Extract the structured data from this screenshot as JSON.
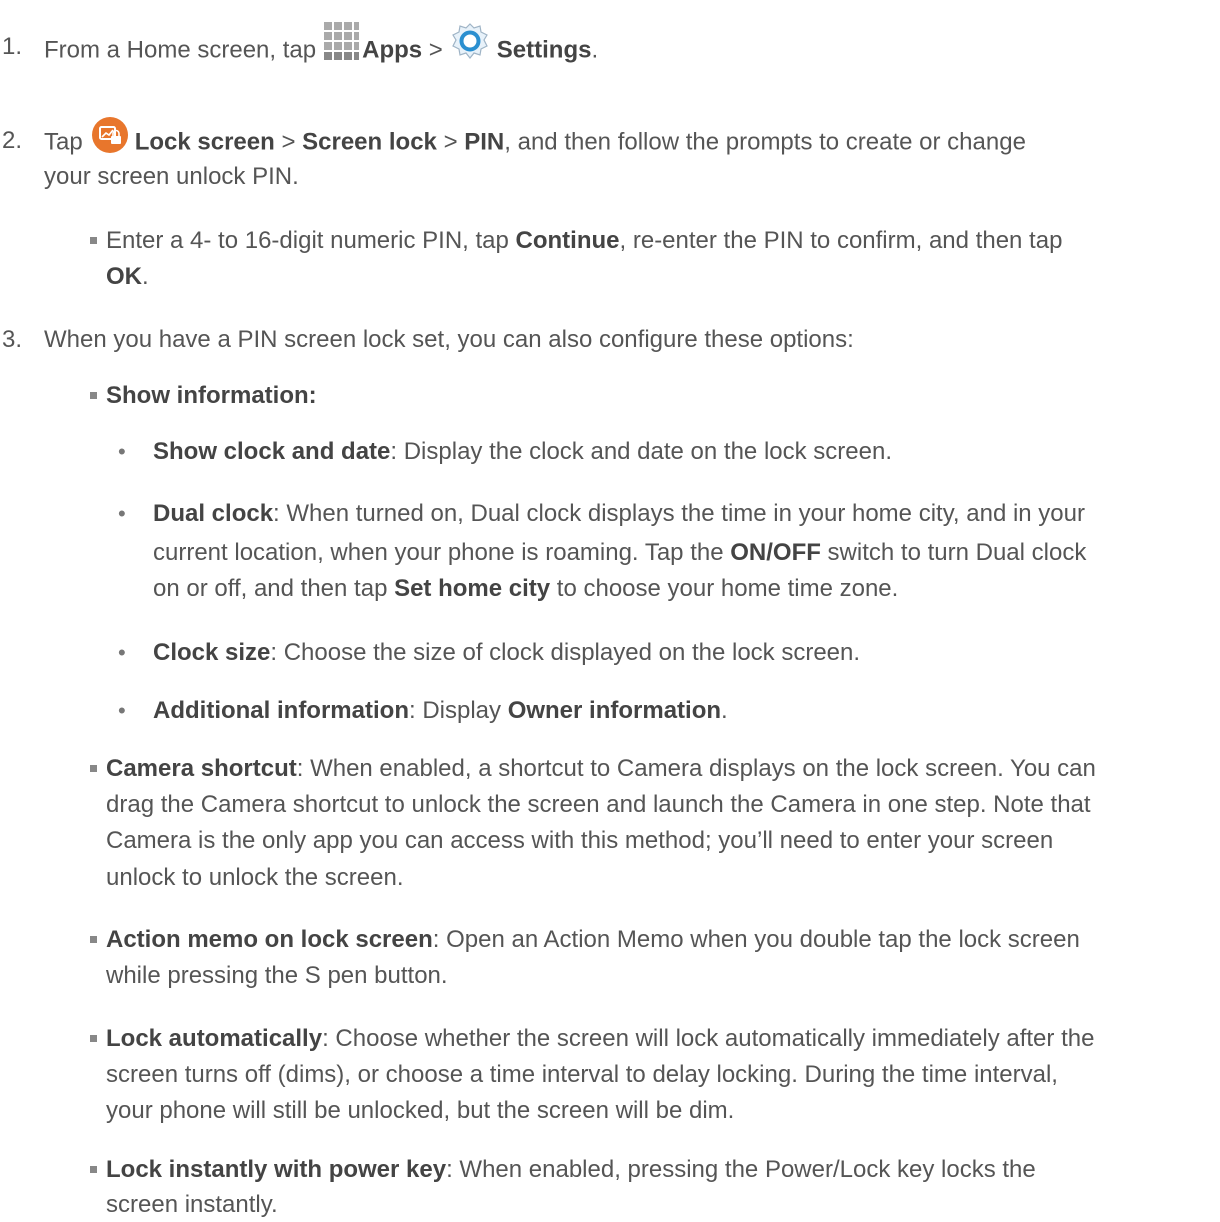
{
  "step1": {
    "number": "1.",
    "prefix": "From a Home screen, tap",
    "apps": "Apps",
    "sep": ">",
    "settings": "Settings",
    "end": "."
  },
  "step2": {
    "number": "2.",
    "tap": "Tap",
    "lock_screen": "Lock screen",
    "sep1": ">",
    "screen_lock": "Screen lock",
    "sep2": ">",
    "pin": "PIN",
    "rest": ", and then follow the prompts to create or change",
    "line2": "your screen unlock PIN.",
    "sub": {
      "line1_a": "Enter a 4- to 16-digit numeric PIN, tap ",
      "continue": "Continue",
      "line1_b": ", re-enter the PIN to confirm, and then tap",
      "ok": "OK",
      "end": "."
    }
  },
  "step3": {
    "number": "3.",
    "intro": "When you have a PIN screen lock set, you can also configure these options:",
    "show_information": "Show information:",
    "show_clock": {
      "title": "Show clock and date",
      "text": ": Display the clock and date on the lock screen."
    },
    "dual_clock": {
      "title": "Dual clock",
      "line1": ": When turned on, Dual clock displays the time in your home city, and in your",
      "line2_a": "current location, when your phone is roaming. Tap the ",
      "onoff": "ON/OFF",
      "line2_b": " switch to turn Dual clock",
      "line3_a": "on or off, and then tap ",
      "set_home": "Set home city",
      "line3_b": " to choose your home time zone."
    },
    "clock_size": {
      "title": "Clock size",
      "text": ": Choose the size of clock displayed on the lock screen."
    },
    "additional": {
      "title": "Additional information",
      "text": ": Display ",
      "owner": "Owner information",
      "end": "."
    },
    "camera": {
      "title": "Camera shortcut",
      "line1": ": When enabled, a shortcut to Camera displays on the lock screen. You can",
      "line2": "drag the Camera shortcut to unlock the screen and launch the Camera in one step. Note that",
      "line3": "Camera is the only app you can access with this method; you’ll need to enter your screen",
      "line4": "unlock to unlock the screen."
    },
    "action_memo": {
      "title": "Action memo on lock screen",
      "line1": ": Open an Action Memo when you double tap the lock screen",
      "line2": "while pressing the S pen button."
    },
    "lock_auto": {
      "title": "Lock automatically",
      "line1": ": Choose whether the screen will lock automatically immediately after the",
      "line2": "screen turns off (dims), or choose a time interval to delay locking. During the time interval,",
      "line3": "your phone will still be unlocked, but the screen will be dim."
    },
    "lock_power": {
      "title": "Lock instantly with power key",
      "line1": ": When enabled, pressing the Power/Lock key locks the",
      "line2": "screen instantly."
    }
  },
  "bullet_char": "•",
  "icons": {
    "apps": "apps-grid-icon",
    "settings": "settings-gear-icon",
    "lock": "lock-screen-icon"
  },
  "colors": {
    "text": "#555555",
    "lock_icon": "#e8762c",
    "gear": "#2a8fd0"
  }
}
